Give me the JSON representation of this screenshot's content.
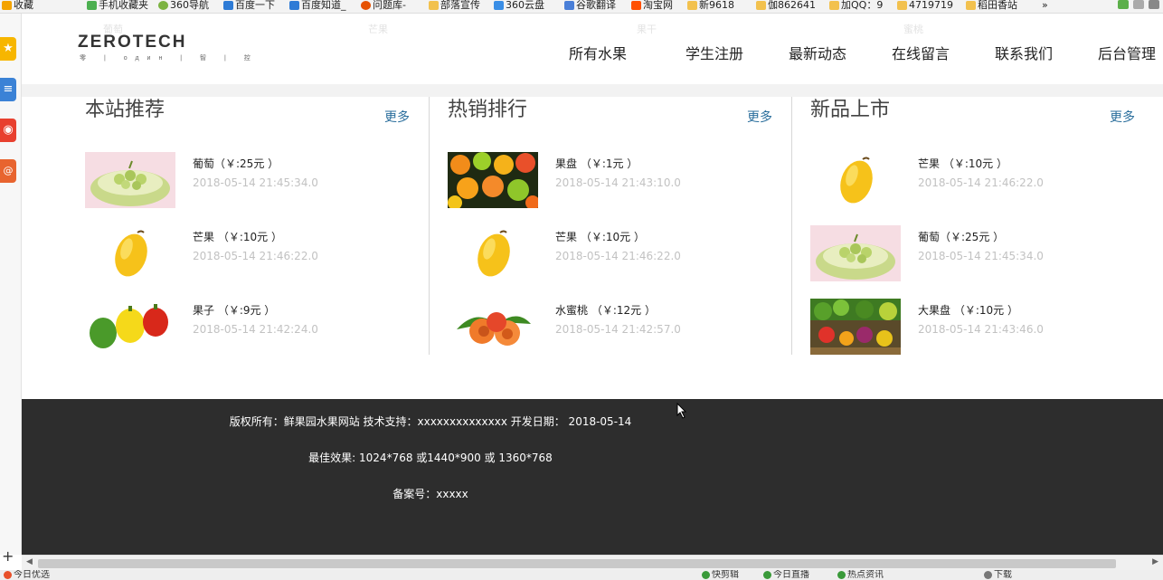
{
  "bookmarks_bar": {
    "items": [
      {
        "label": "收藏",
        "icon": "star-icon",
        "color": "#f4a300"
      },
      {
        "label": "手机收藏夹",
        "icon": "phone-icon",
        "color": "#4caf50"
      },
      {
        "label": "360导航",
        "icon": "360-icon",
        "color": "#7cb342"
      },
      {
        "label": "百度一下",
        "icon": "baidu-paw-icon",
        "color": "#2e7bd6"
      },
      {
        "label": "百度知道_",
        "icon": "baidu-paw-icon",
        "color": "#2e7bd6"
      },
      {
        "label": "问题库-",
        "icon": "s-icon",
        "color": "#e65100"
      },
      {
        "label": "部落宣传",
        "icon": "folder-icon",
        "color": "#f2c14e"
      },
      {
        "label": "360云盘",
        "icon": "cloud-icon",
        "color": "#3a8ee6"
      },
      {
        "label": "谷歌翻译",
        "icon": "translate-icon",
        "color": "#4a7fd8"
      },
      {
        "label": "淘宝网",
        "icon": "taobao-icon",
        "color": "#ff5000"
      },
      {
        "label": "新9618",
        "icon": "folder-icon",
        "color": "#f2c14e"
      },
      {
        "label": "伽862641",
        "icon": "folder-icon",
        "color": "#f2c14e"
      },
      {
        "label": "加QQ：9",
        "icon": "folder-icon",
        "color": "#f2c14e"
      },
      {
        "label": "4719719",
        "icon": "folder-icon",
        "color": "#f2c14e"
      },
      {
        "label": "稻田香站",
        "icon": "folder-icon",
        "color": "#f2c14e"
      }
    ],
    "more": "»"
  },
  "header": {
    "logo_text": "ZEROTECH",
    "logo_sub": "零 | один | 智 | 控",
    "ghost_labels": [
      "葡萄",
      "芒果",
      "果干",
      "蜜桃"
    ],
    "nav": [
      "所有水果",
      "学生注册",
      "最新动态",
      "在线留言",
      "联系我们",
      "后台管理"
    ]
  },
  "sections": [
    {
      "title": "本站推荐",
      "more": "更多",
      "items": [
        {
          "name": "葡萄（￥:25元 ）",
          "date": "2018-05-14 21:45:34.0",
          "image": "melon-grape-plate"
        },
        {
          "name": "芒果 （￥:10元 ）",
          "date": "2018-05-14 21:46:22.0",
          "image": "mango"
        },
        {
          "name": "果子 （￥:9元 ）",
          "date": "2018-05-14 21:42:24.0",
          "image": "bell-peppers"
        }
      ]
    },
    {
      "title": "热销排行",
      "more": "更多",
      "items": [
        {
          "name": "果盘 （￥:1元 ）",
          "date": "2018-05-14 21:43:10.0",
          "image": "citrus-slices"
        },
        {
          "name": "芒果 （￥:10元 ）",
          "date": "2018-05-14 21:46:22.0",
          "image": "mango"
        },
        {
          "name": "水蜜桃 （￥:12元 ）",
          "date": "2018-05-14 21:42:57.0",
          "image": "peaches"
        }
      ]
    },
    {
      "title": "新品上市",
      "more": "更多",
      "items": [
        {
          "name": "芒果 （￥:10元 ）",
          "date": "2018-05-14 21:46:22.0",
          "image": "mango"
        },
        {
          "name": "葡萄（￥:25元 ）",
          "date": "2018-05-14 21:45:34.0",
          "image": "melon-grape-plate"
        },
        {
          "name": "大果盘 （￥:10元 ）",
          "date": "2018-05-14 21:43:46.0",
          "image": "vegetable-platter"
        }
      ]
    }
  ],
  "footer": {
    "line1": "版权所有：鲜果园水果网站 技术支持：xxxxxxxxxxxxxx 开发日期： 2018-05-14",
    "line2": "最佳效果: 1024*768 或1440*900 或 1360*768",
    "line3": "备案号：xxxxx"
  },
  "status_bar": {
    "left": "今日优选",
    "items": [
      "快剪辑",
      "今日直播",
      "热点资讯",
      "下载"
    ]
  },
  "colors": {
    "link": "#2a6e9c",
    "footer_bg": "#2d2d2d",
    "date_gray": "#c2c2c2"
  }
}
